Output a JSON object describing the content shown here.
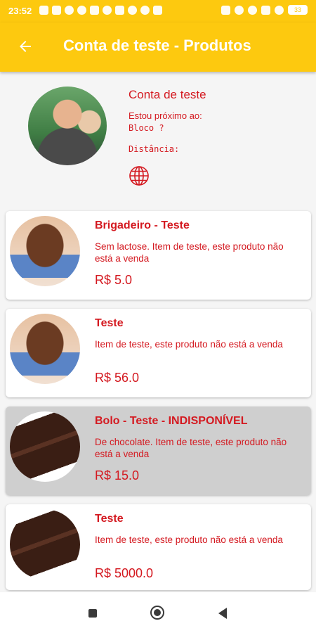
{
  "status_bar": {
    "time": "23:52",
    "battery": "33"
  },
  "app_bar": {
    "title": "Conta de teste - Produtos",
    "back_icon": "arrow-left-icon"
  },
  "profile": {
    "name": "Conta de teste",
    "near_label": "Estou próximo ao:",
    "near_value": "Bloco ?",
    "distance_label": "Distância:",
    "map_icon": "globe-icon"
  },
  "products": [
    {
      "title": "Brigadeiro - Teste",
      "description": "Sem lactose. Item de teste, este produto não está a venda",
      "price": "R$ 5.0",
      "image": "brigadeiro",
      "unavailable": false
    },
    {
      "title": "Teste",
      "description": "Item de teste, este produto não está a venda",
      "price": "R$ 56.0",
      "image": "brigadeiro",
      "unavailable": false
    },
    {
      "title": "Bolo - Teste - INDISPONÍVEL",
      "description": "De chocolate. Item de teste, este produto não está a venda",
      "price": "R$ 15.0",
      "image": "bolo",
      "unavailable": true
    },
    {
      "title": "Teste",
      "description": "Item de teste, este produto não está a venda",
      "price": "R$ 5000.0",
      "image": "bolo",
      "unavailable": false
    }
  ],
  "colors": {
    "primary": "#fdc90f",
    "accent_text": "#d41920",
    "unavailable_bg": "#cfcfcf"
  }
}
